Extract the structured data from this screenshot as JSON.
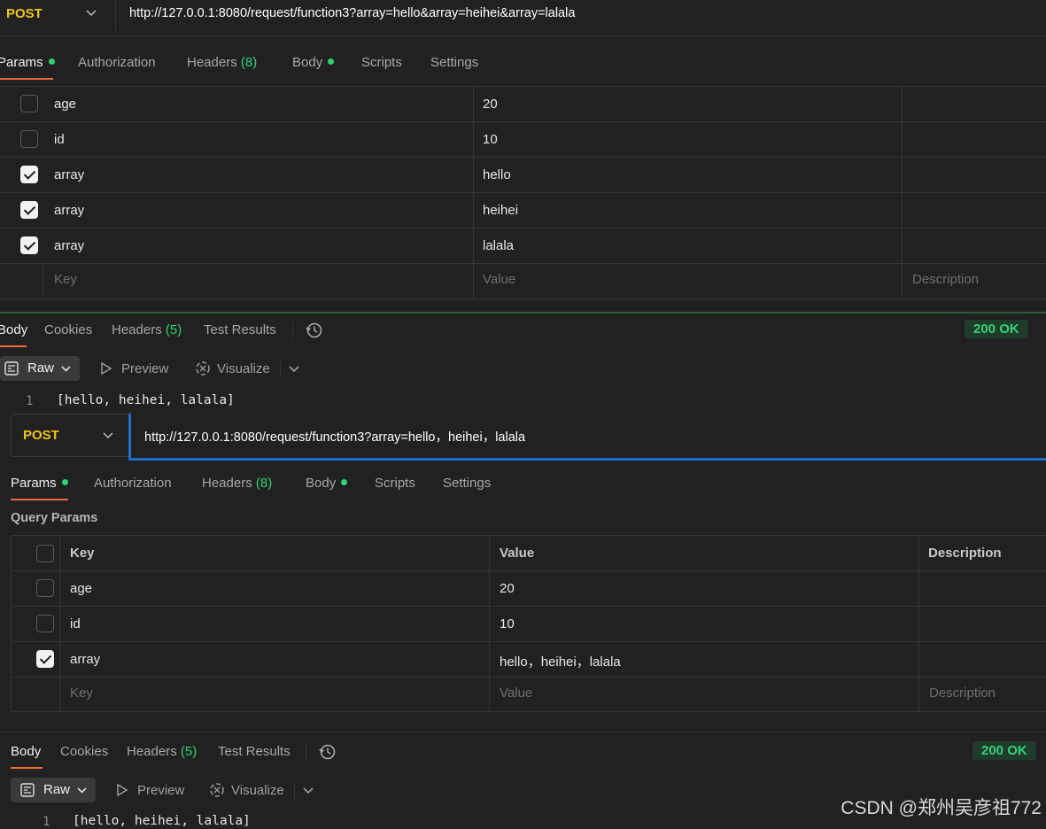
{
  "top": {
    "method": "POST",
    "url": "http://127.0.0.1:8080/request/function3?array=hello&array=heihei&array=lalala",
    "tabs": {
      "params": "Params",
      "authorization": "Authorization",
      "headers": "Headers",
      "headers_count": "(8)",
      "body": "Body",
      "scripts": "Scripts",
      "settings": "Settings"
    },
    "rows": [
      {
        "key": "age",
        "value": "20",
        "checked": false
      },
      {
        "key": "id",
        "value": "10",
        "checked": false
      },
      {
        "key": "array",
        "value": "hello",
        "checked": true
      },
      {
        "key": "array",
        "value": "heihei",
        "checked": true
      },
      {
        "key": "array",
        "value": "lalala",
        "checked": true
      }
    ],
    "placeholders": {
      "key": "Key",
      "value": "Value",
      "description": "Description"
    },
    "response": {
      "tabs": {
        "body": "Body",
        "cookies": "Cookies",
        "headers": "Headers",
        "headers_count": "(5)",
        "test_results": "Test Results"
      },
      "status": "200 OK",
      "format": "Raw",
      "preview": "Preview",
      "visualize": "Visualize",
      "line_number": "1",
      "body_text": "[hello, heihei, lalala]"
    }
  },
  "bottom": {
    "method": "POST",
    "url": "http://127.0.0.1:8080/request/function3?array=hello，heihei，lalala",
    "tabs": {
      "params": "Params",
      "authorization": "Authorization",
      "headers": "Headers",
      "headers_count": "(8)",
      "body": "Body",
      "scripts": "Scripts",
      "settings": "Settings"
    },
    "section_title": "Query Params",
    "columns": {
      "key": "Key",
      "value": "Value",
      "description": "Description"
    },
    "rows": [
      {
        "key": "age",
        "value": "20",
        "checked": false
      },
      {
        "key": "id",
        "value": "10",
        "checked": false
      },
      {
        "key": "array",
        "value": "hello，heihei，lalala",
        "checked": true
      }
    ],
    "placeholders": {
      "key": "Key",
      "value": "Value",
      "description": "Description"
    },
    "response": {
      "tabs": {
        "body": "Body",
        "cookies": "Cookies",
        "headers": "Headers",
        "headers_count": "(5)",
        "test_results": "Test Results"
      },
      "status": "200 OK",
      "format": "Raw",
      "preview": "Preview",
      "visualize": "Visualize",
      "line_number": "1",
      "body_text": "[hello, heihei, lalala]"
    }
  },
  "watermark": "CSDN @郑州吴彦祖772",
  "colors": {
    "accent": "#f26b3a",
    "method": "#f0c419",
    "success": "#33d17a",
    "focus": "#1f6fd1"
  }
}
